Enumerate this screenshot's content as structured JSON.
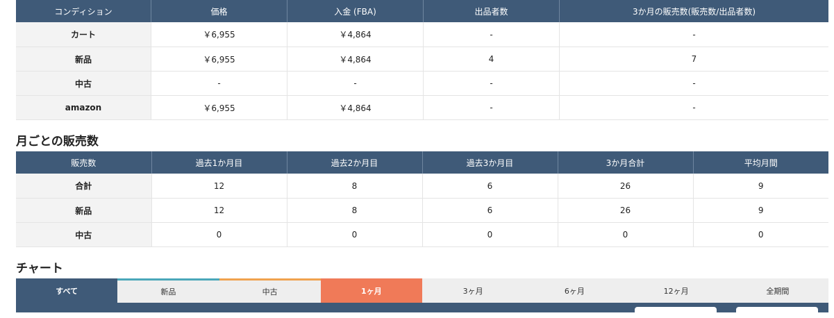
{
  "price_table": {
    "headers": [
      "コンディション",
      "価格",
      "入金 (FBA)",
      "出品者数",
      "3か月の販売数(販売数/出品者数)"
    ],
    "rows": [
      [
        "カート",
        "￥6,955",
        "￥4,864",
        "-",
        "-"
      ],
      [
        "新品",
        "￥6,955",
        "￥4,864",
        "4",
        "7"
      ],
      [
        "中古",
        "-",
        "-",
        "-",
        "-"
      ],
      [
        "amazon",
        "￥6,955",
        "￥4,864",
        "-",
        "-"
      ]
    ]
  },
  "monthly": {
    "title": "月ごとの販売数",
    "headers": [
      "販売数",
      "過去1か月目",
      "過去2か月目",
      "過去3か月目",
      "3か月合計",
      "平均月間"
    ],
    "rows": [
      [
        "合計",
        "12",
        "8",
        "6",
        "26",
        "9"
      ],
      [
        "新品",
        "12",
        "8",
        "6",
        "26",
        "9"
      ],
      [
        "中古",
        "0",
        "0",
        "0",
        "0",
        "0"
      ]
    ]
  },
  "chart": {
    "title": "チャート",
    "tabs": [
      "すべて",
      "新品",
      "中古",
      "1ヶ月",
      "3ヶ月",
      "6ヶ月",
      "12ヶ月",
      "全期間"
    ],
    "active_tab": "1ヶ月",
    "colors": {
      "header": "#3f5a78",
      "new": "#4aa7b9",
      "used": "#f0a24e",
      "active": "#f07a58"
    }
  }
}
